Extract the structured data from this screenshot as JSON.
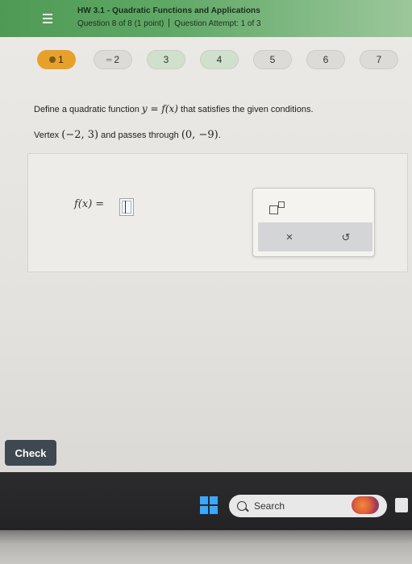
{
  "header": {
    "title": "HW 3.1 - Quadratic Functions and Applications",
    "subtitle_left": "Question 8 of 8 (1 point)",
    "subtitle_right": "Question Attempt: 1 of 3"
  },
  "question_nav": [
    {
      "label": "1",
      "state": "current"
    },
    {
      "label": "2",
      "state": "partial"
    },
    {
      "label": "3",
      "state": "answered"
    },
    {
      "label": "4",
      "state": "default"
    },
    {
      "label": "5",
      "state": "default"
    },
    {
      "label": "6",
      "state": "default"
    },
    {
      "label": "7",
      "state": "default"
    }
  ],
  "question": {
    "prompt_prefix": "Define a quadratic function ",
    "prompt_math": "y = f(x)",
    "prompt_suffix": " that satisfies the given conditions.",
    "cond_vertex_label": "Vertex ",
    "cond_vertex": "(−2, 3)",
    "cond_mid": " and passes through ",
    "cond_point": "(0, −9)",
    "cond_end": "."
  },
  "answer": {
    "lhs": "f(x)",
    "equals": "=",
    "value": ""
  },
  "palette": {
    "exponent_icon": "exponent-template-icon",
    "clear_symbol": "×",
    "undo_symbol": "↺"
  },
  "check_label": "Check",
  "taskbar": {
    "search_label": "Search"
  },
  "colors": {
    "header_green": "#5ea865",
    "current_pill": "#e7a12b",
    "check_button": "#3e4850"
  }
}
